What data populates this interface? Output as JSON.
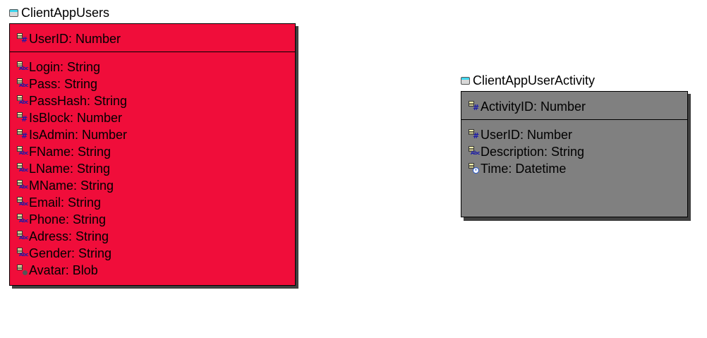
{
  "colors": {
    "client_app_users_fill": "#f00d3a",
    "client_app_user_activity_fill": "#808080"
  },
  "entities": [
    {
      "name": "ClientAppUsers",
      "icon": "table-icon",
      "primary_keys": [
        {
          "label": "UserID: Number",
          "type_icon": "number-icon"
        }
      ],
      "attributes": [
        {
          "label": "Login: String",
          "type_icon": "string-icon"
        },
        {
          "label": "Pass: String",
          "type_icon": "string-icon"
        },
        {
          "label": "PassHash: String",
          "type_icon": "string-icon"
        },
        {
          "label": "IsBlock: Number",
          "type_icon": "number-icon"
        },
        {
          "label": "IsAdmin: Number",
          "type_icon": "number-icon"
        },
        {
          "label": "FName: String",
          "type_icon": "string-icon"
        },
        {
          "label": "LName: String",
          "type_icon": "string-icon"
        },
        {
          "label": "MName: String",
          "type_icon": "string-icon"
        },
        {
          "label": "Email: String",
          "type_icon": "string-icon"
        },
        {
          "label": "Phone: String",
          "type_icon": "string-icon"
        },
        {
          "label": "Adress: String",
          "type_icon": "string-icon"
        },
        {
          "label": "Gender: String",
          "type_icon": "string-icon"
        },
        {
          "label": "Avatar: Blob",
          "type_icon": "blob-icon"
        }
      ]
    },
    {
      "name": "ClientAppUserActivity",
      "icon": "table-icon",
      "primary_keys": [
        {
          "label": "ActivityID: Number",
          "type_icon": "number-icon"
        }
      ],
      "attributes": [
        {
          "label": "UserID: Number",
          "type_icon": "number-icon"
        },
        {
          "label": "Description: String",
          "type_icon": "string-icon"
        },
        {
          "label": "Time: Datetime",
          "type_icon": "datetime-icon"
        }
      ]
    }
  ]
}
